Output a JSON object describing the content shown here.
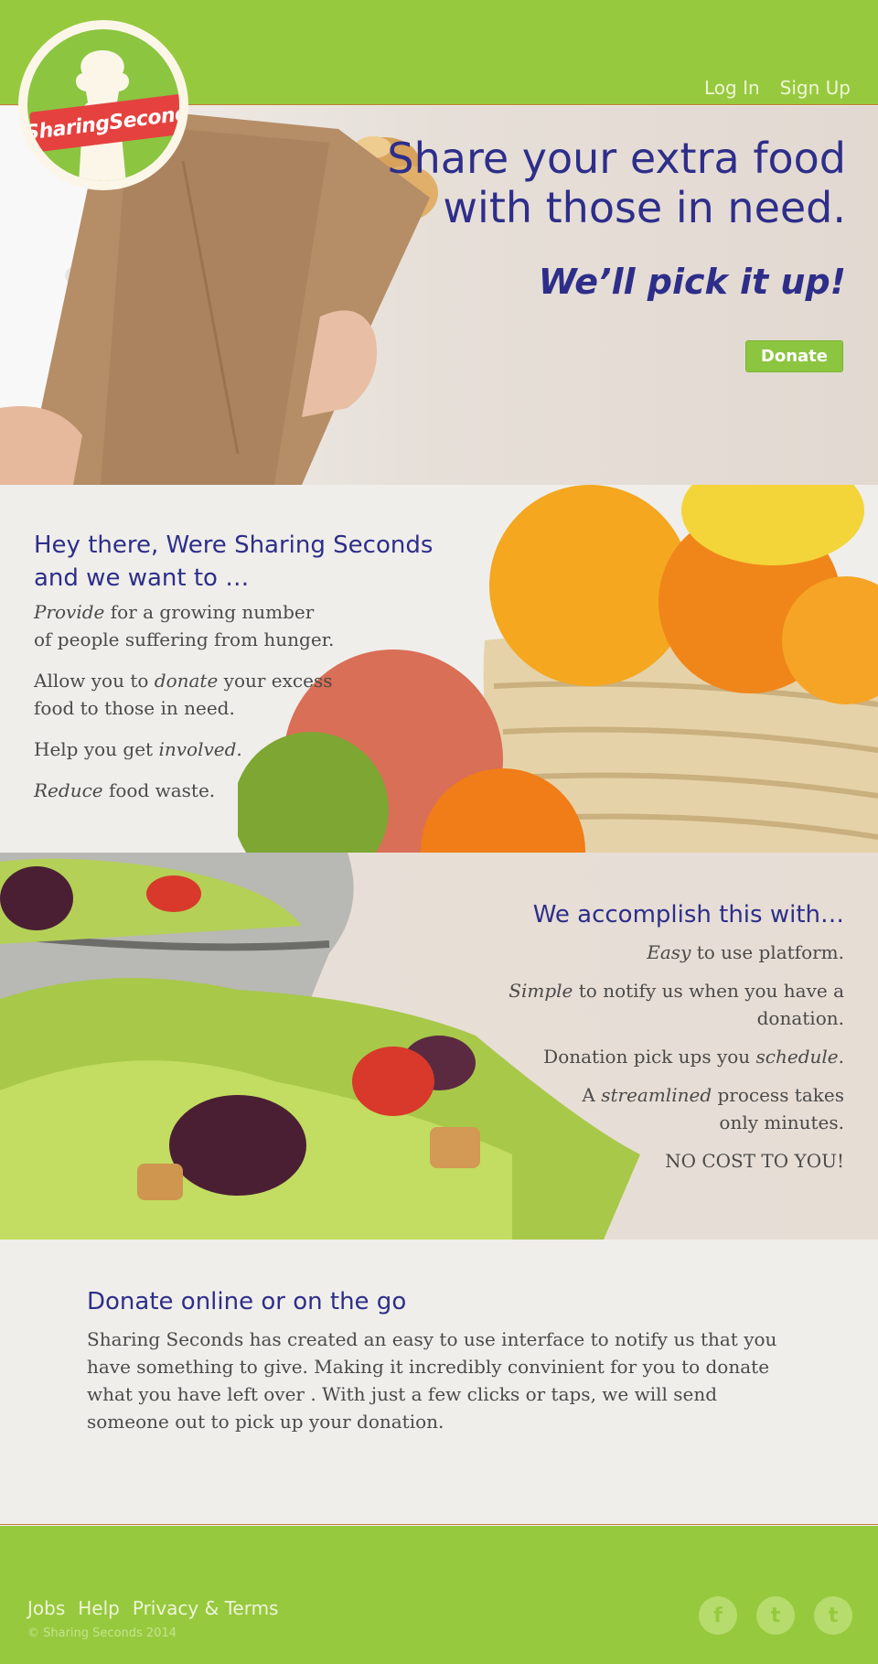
{
  "header": {
    "logo_text": "SharingSeconds",
    "nav": {
      "login": "Log In",
      "signup": "Sign Up"
    }
  },
  "hero": {
    "title_line1": "Share your extra food",
    "title_line2": "with those in need.",
    "subtitle": "We’ll pick it up!",
    "donate_label": "Donate"
  },
  "intro": {
    "heading_line1": "Hey there, Were Sharing Seconds",
    "heading_line2": "and we want to …",
    "items": [
      {
        "em": "Provide",
        "rest": " for a growing number of people suffering from hunger."
      },
      {
        "pre": "Allow you to ",
        "em": "donate",
        "rest": " your excess food to those in need."
      },
      {
        "pre": "Help you get ",
        "em": "involved",
        "rest": "."
      },
      {
        "em": "Reduce",
        "rest": " food waste."
      }
    ]
  },
  "accomplish": {
    "heading": "We accomplish this with…",
    "items": [
      {
        "em": "Easy",
        "rest": " to use platform."
      },
      {
        "em": "Simple",
        "rest": " to notify us when you have a donation."
      },
      {
        "pre": "Donation pick ups you ",
        "em": "schedule",
        "rest": "."
      },
      {
        "pre": "A ",
        "em": "streamlined",
        "rest": " process takes only minutes."
      },
      {
        "pre": "NO COST TO YOU!",
        "em": "",
        "rest": ""
      }
    ]
  },
  "online": {
    "heading": "Donate online or on the go",
    "body": "Sharing Seconds has created an easy to use interface to notify us that you have something to give. Making it incredibly convinient for you to donate what you have left over . With just a few clicks or taps, we will send someone out to pick up your donation."
  },
  "footer": {
    "links": [
      "Jobs",
      "Help",
      "Privacy & Terms"
    ],
    "copyright": "© Sharing Seconds 2014",
    "social": [
      {
        "icon": "facebook-icon",
        "glyph": "f"
      },
      {
        "icon": "twitter-icon",
        "glyph": "t"
      },
      {
        "icon": "tumblr-icon",
        "glyph": "t"
      }
    ]
  },
  "colors": {
    "brand_green": "#97c93e",
    "heading_blue": "#2e2e8a",
    "logo_red": "#e4413f"
  }
}
